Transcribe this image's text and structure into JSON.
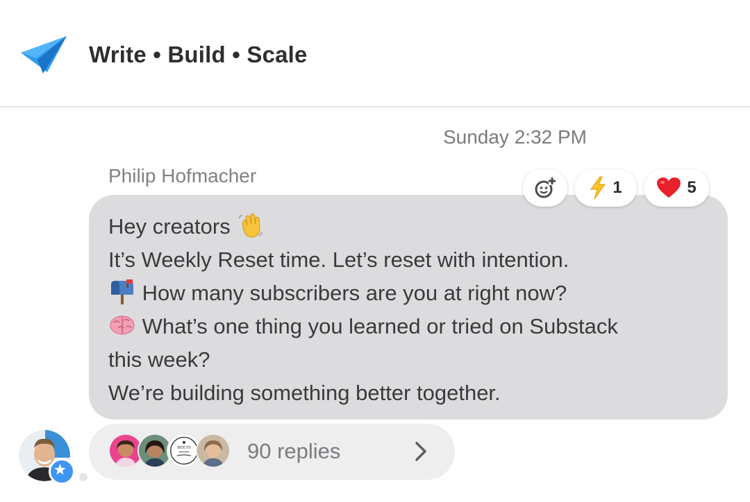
{
  "header": {
    "title": "Write • Build • Scale",
    "logo_icon": "paper-plane-icon",
    "logo_color": "#2f9bf0"
  },
  "message": {
    "timestamp": "Sunday 2:32 PM",
    "sender": "Philip Hofmacher",
    "lines": [
      {
        "emoji": "waving-hand-icon",
        "text": "Hey creators ",
        "emoji_after": true
      },
      {
        "text": "It’s Weekly Reset time. Let’s reset with intention."
      },
      {
        "emoji": "mailbox-icon",
        "text": " How many subscribers are you at right now?"
      },
      {
        "emoji": "brain-icon",
        "text": " What’s one thing you learned or tried on Substack"
      },
      {
        "text": "this week?"
      },
      {
        "text": "We’re building something better together."
      }
    ],
    "bubble_color": "#dcdcde"
  },
  "reactions": {
    "add_reaction_icon": "add-reaction-icon",
    "items": [
      {
        "icon": "lightning-icon",
        "count": "1"
      },
      {
        "icon": "heart-icon",
        "count": "5"
      }
    ]
  },
  "replies": {
    "label": "90 replies",
    "avatar_icons": [
      "reply-avatar-1",
      "reply-avatar-2",
      "reply-avatar-beets",
      "reply-avatar-4"
    ],
    "beets_logo_text": "BEETS",
    "chevron_icon": "chevron-right-icon"
  },
  "author": {
    "avatar_icon": "author-avatar",
    "badge_icon": "star-badge-icon",
    "badge_color": "#3f96f0"
  }
}
